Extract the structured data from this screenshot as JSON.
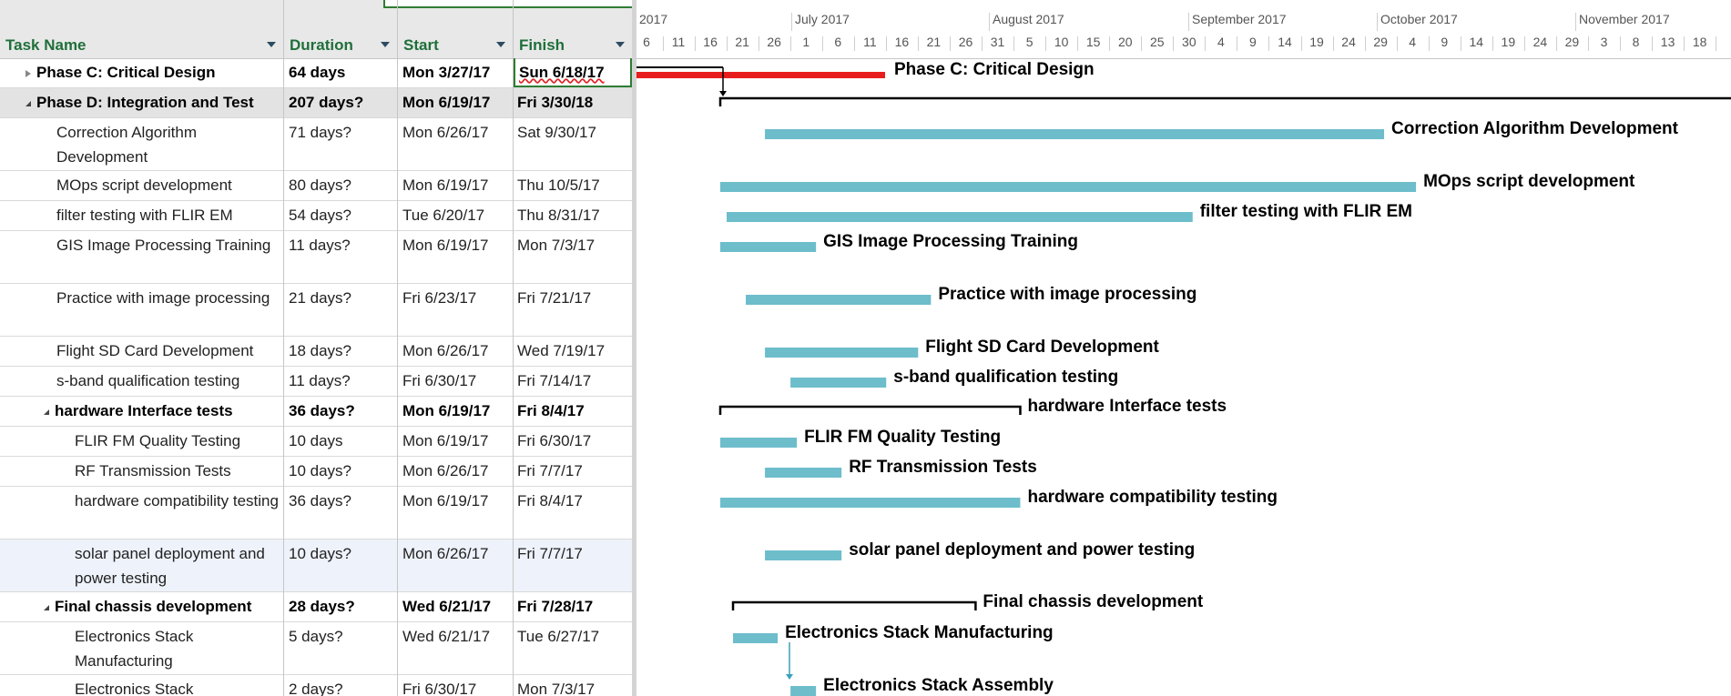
{
  "columns": {
    "task_name": "Task Name",
    "duration": "Duration",
    "start": "Start",
    "finish": "Finish"
  },
  "timescale": {
    "months": [
      "2017",
      "July 2017",
      "August 2017",
      "September 2017",
      "October 2017",
      "November 2017"
    ],
    "days": [
      "6",
      "11",
      "16",
      "21",
      "26",
      "1",
      "6",
      "11",
      "16",
      "21",
      "26",
      "31",
      "5",
      "10",
      "15",
      "20",
      "25",
      "30",
      "4",
      "9",
      "14",
      "19",
      "24",
      "29",
      "4",
      "9",
      "14",
      "19",
      "24",
      "29",
      "3",
      "8",
      "13",
      "18"
    ]
  },
  "tasks": [
    {
      "name": "Phase C: Critical Design",
      "duration": "64 days",
      "start": "Mon 3/27/17",
      "finish": "Sun 6/18/17",
      "level": 0,
      "summary": true,
      "state": "collapsed",
      "bar_start": "2017-06-02",
      "bar_end": "2017-06-18",
      "label": "Phase C: Critical Design",
      "bar_color": "#e81c1c"
    },
    {
      "name": "Phase D: Integration and Test",
      "duration": "207 days?",
      "start": "Mon 6/19/17",
      "finish": "Fri 3/30/18",
      "level": 0,
      "summary": true,
      "state": "expanded",
      "bar_start": "2017-06-19",
      "bar_end": "2017-11-30",
      "label": "",
      "bar_color": "#000000"
    },
    {
      "name": "Correction Algorithm Development",
      "duration": "71 days?",
      "start": "Mon 6/26/17",
      "finish": "Sat 9/30/17",
      "level": 1,
      "bar_start": "2017-06-26",
      "bar_end": "2017-09-30",
      "label": "Correction Algorithm Development",
      "bar_color": "#6dbdcb"
    },
    {
      "name": "MOps script development",
      "duration": "80 days?",
      "start": "Mon 6/19/17",
      "finish": "Thu 10/5/17",
      "level": 1,
      "bar_start": "2017-06-19",
      "bar_end": "2017-10-05",
      "label": "MOps script development",
      "bar_color": "#6dbdcb"
    },
    {
      "name": "filter testing with FLIR EM",
      "duration": "54 days?",
      "start": "Tue 6/20/17",
      "finish": "Thu 8/31/17",
      "level": 1,
      "bar_start": "2017-06-20",
      "bar_end": "2017-08-31",
      "label": "filter testing with FLIR EM",
      "bar_color": "#6dbdcb"
    },
    {
      "name": "GIS Image Processing Training",
      "duration": "11 days?",
      "start": "Mon 6/19/17",
      "finish": "Mon 7/3/17",
      "level": 1,
      "bar_start": "2017-06-19",
      "bar_end": "2017-07-03",
      "label": "GIS Image Processing Training",
      "bar_color": "#6dbdcb"
    },
    {
      "name": "Practice with image processing",
      "duration": "21 days?",
      "start": "Fri 6/23/17",
      "finish": "Fri 7/21/17",
      "level": 1,
      "bar_start": "2017-06-23",
      "bar_end": "2017-07-21",
      "label": "Practice with image processing",
      "bar_color": "#6dbdcb"
    },
    {
      "name": "Flight SD Card Development",
      "duration": "18 days?",
      "start": "Mon 6/26/17",
      "finish": "Wed 7/19/17",
      "level": 1,
      "bar_start": "2017-06-26",
      "bar_end": "2017-07-19",
      "label": "Flight SD Card Development",
      "bar_color": "#6dbdcb"
    },
    {
      "name": "s-band qualification testing",
      "duration": "11 days?",
      "start": "Fri 6/30/17",
      "finish": "Fri 7/14/17",
      "level": 1,
      "bar_start": "2017-06-30",
      "bar_end": "2017-07-14",
      "label": "s-band qualification testing",
      "bar_color": "#6dbdcb"
    },
    {
      "name": "hardware Interface tests",
      "duration": "36 days?",
      "start": "Mon 6/19/17",
      "finish": "Fri 8/4/17",
      "level": 1,
      "summary": true,
      "state": "expanded",
      "bar_start": "2017-06-19",
      "bar_end": "2017-08-04",
      "label": "hardware Interface tests",
      "bar_color": "#000000"
    },
    {
      "name": "FLIR FM Quality Testing",
      "duration": "10 days",
      "start": "Mon 6/19/17",
      "finish": "Fri 6/30/17",
      "level": 2,
      "bar_start": "2017-06-19",
      "bar_end": "2017-06-30",
      "label": "FLIR FM Quality Testing",
      "bar_color": "#6dbdcb"
    },
    {
      "name": "RF Transmission Tests",
      "duration": "10 days?",
      "start": "Mon 6/26/17",
      "finish": "Fri 7/7/17",
      "level": 2,
      "bar_start": "2017-06-26",
      "bar_end": "2017-07-07",
      "label": "RF Transmission Tests",
      "bar_color": "#6dbdcb"
    },
    {
      "name": "hardware compatibility testing",
      "duration": "36 days?",
      "start": "Mon 6/19/17",
      "finish": "Fri 8/4/17",
      "level": 2,
      "bar_start": "2017-06-19",
      "bar_end": "2017-08-04",
      "label": "hardware compatibility testing",
      "bar_color": "#6dbdcb"
    },
    {
      "name": "solar panel deployment and power testing",
      "duration": "10 days?",
      "start": "Mon 6/26/17",
      "finish": "Fri 7/7/17",
      "level": 2,
      "bar_start": "2017-06-26",
      "bar_end": "2017-07-07",
      "label": "solar panel deployment and power testing",
      "bar_color": "#6dbdcb"
    },
    {
      "name": "Final chassis development",
      "duration": "28 days?",
      "start": "Wed 6/21/17",
      "finish": "Fri 7/28/17",
      "level": 1,
      "summary": true,
      "state": "expanded",
      "bar_start": "2017-06-21",
      "bar_end": "2017-07-28",
      "label": "Final chassis development",
      "bar_color": "#000000"
    },
    {
      "name": "Electronics Stack Manufacturing",
      "duration": "5 days?",
      "start": "Wed 6/21/17",
      "finish": "Tue 6/27/17",
      "level": 2,
      "bar_start": "2017-06-21",
      "bar_end": "2017-06-27",
      "label": "Electronics Stack Manufacturing",
      "bar_color": "#6dbdcb"
    },
    {
      "name": "Electronics Stack",
      "duration": "2 days?",
      "start": "Fri 6/30/17",
      "finish": "Mon 7/3/17",
      "level": 2,
      "bar_start": "2017-06-30",
      "bar_end": "2017-07-03",
      "label": "Electronics Stack Assembly",
      "bar_color": "#6dbdcb"
    }
  ]
}
